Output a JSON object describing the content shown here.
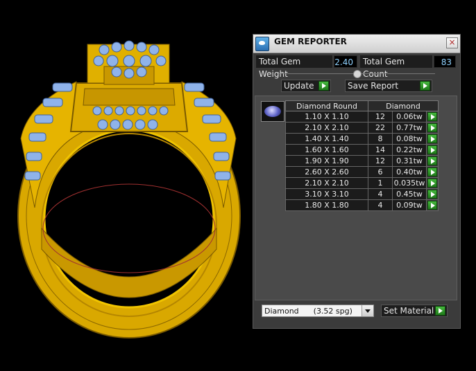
{
  "window": {
    "title": "GEM REPORTER",
    "close_glyph": "×"
  },
  "stats": {
    "weight_label": "Total Gem Weight",
    "weight_value": "2.40",
    "count_label": "Total Gem Count",
    "count_value": "83"
  },
  "actions": {
    "update_label": "Update",
    "save_report_label": "Save Report",
    "set_material_label": "Set Material"
  },
  "table": {
    "columns": [
      "Diamond Round",
      "Diamond"
    ],
    "rows": [
      {
        "size": "1.10 X 1.10",
        "count": "12",
        "weight": "0.06tw"
      },
      {
        "size": "2.10 X 2.10",
        "count": "22",
        "weight": "0.77tw"
      },
      {
        "size": "1.40 X 1.40",
        "count": "8",
        "weight": "0.08tw"
      },
      {
        "size": "1.60 X 1.60",
        "count": "14",
        "weight": "0.22tw"
      },
      {
        "size": "1.90 X 1.90",
        "count": "12",
        "weight": "0.31tw"
      },
      {
        "size": "2.60 X 2.60",
        "count": "6",
        "weight": "0.40tw"
      },
      {
        "size": "2.10 X 2.10",
        "count": "1",
        "weight": "0.035tw"
      },
      {
        "size": "3.10 X 3.10",
        "count": "4",
        "weight": "0.45tw"
      },
      {
        "size": "1.80 X 1.80",
        "count": "4",
        "weight": "0.09tw"
      }
    ]
  },
  "material": {
    "selected": "Diamond      (3.52 spg)"
  },
  "icons": [
    "gem-reporter-app-icon",
    "close-icon",
    "diamond-gem-icon",
    "green-play-arrow-icon",
    "dropdown-arrow-icon"
  ],
  "colors": {
    "gold": "#e0b000",
    "gem_blue": "#8fb3ea",
    "value_text": "#8fd2ff",
    "play_green": "#2f9e28"
  }
}
